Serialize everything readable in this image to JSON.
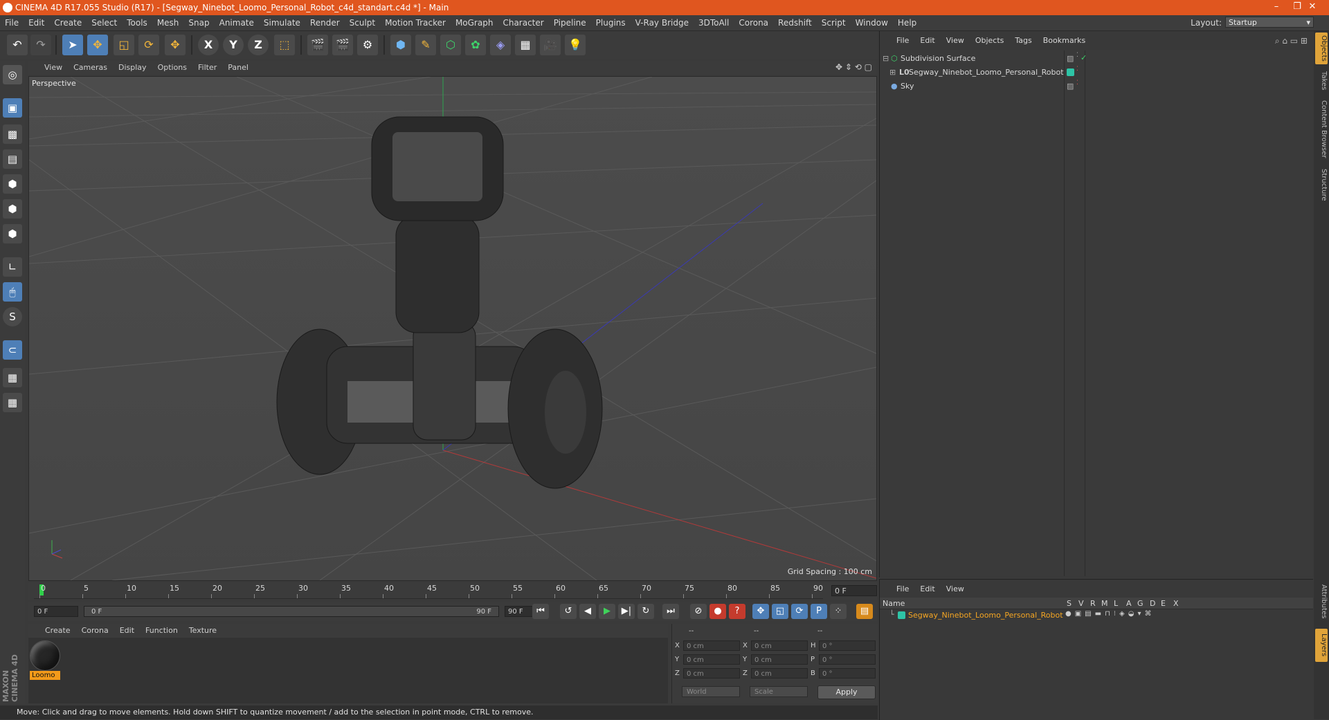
{
  "window": {
    "title": "CINEMA 4D R17.055 Studio (R17) - [Segway_Ninebot_Loomo_Personal_Robot_c4d_standart.c4d *] - Main",
    "controls": [
      "–",
      "❐",
      "✕"
    ]
  },
  "menubar": {
    "items": [
      "File",
      "Edit",
      "Create",
      "Select",
      "Tools",
      "Mesh",
      "Snap",
      "Animate",
      "Simulate",
      "Render",
      "Sculpt",
      "Motion Tracker",
      "MoGraph",
      "Character",
      "Pipeline",
      "Plugins",
      "V-Ray Bridge",
      "3DToAll",
      "Corona",
      "Redshift",
      "Script",
      "Window",
      "Help"
    ],
    "layout_label": "Layout:",
    "layout_value": "Startup"
  },
  "toolbar": {
    "icons": [
      "undo-icon",
      "redo-icon",
      "live-selection-icon",
      "move-icon",
      "scale-icon",
      "rotate-icon",
      "recent-tool-icon",
      "x-axis-icon",
      "y-axis-icon",
      "z-axis-icon",
      "world-coordinates-icon",
      "render-view-icon",
      "render-picture-viewer-icon",
      "edit-render-settings-icon",
      "cube-icon",
      "pen-spline-icon",
      "subdivision-surface-icon",
      "cloner-icon",
      "deformer-icon",
      "floor-icon",
      "camera-icon",
      "light-icon"
    ],
    "axis_labels": [
      "X",
      "Y",
      "Z"
    ]
  },
  "viewport": {
    "menu": [
      "View",
      "Cameras",
      "Display",
      "Options",
      "Filter",
      "Panel"
    ],
    "label": "Perspective",
    "grid_spacing": "Grid Spacing : 100 cm"
  },
  "timeline": {
    "ticks": [
      "0",
      "5",
      "10",
      "15",
      "20",
      "25",
      "30",
      "35",
      "40",
      "45",
      "50",
      "55",
      "60",
      "65",
      "70",
      "75",
      "80",
      "85",
      "90"
    ],
    "current_frame": "0 F",
    "start_field": "0 F",
    "range_start": "0 F",
    "range_end": "90 F",
    "end_field": "90 F"
  },
  "materials": {
    "menu": [
      "Create",
      "Corona",
      "Edit",
      "Function",
      "Texture"
    ],
    "items": [
      {
        "name": "Loomo"
      }
    ]
  },
  "coordinates": {
    "headers": [
      "--",
      "--",
      "--"
    ],
    "rows": [
      {
        "a_label": "X",
        "a_val": "0 cm",
        "b_label": "X",
        "b_val": "0 cm",
        "c_label": "H",
        "c_val": "0 °"
      },
      {
        "a_label": "Y",
        "a_val": "0 cm",
        "b_label": "Y",
        "b_val": "0 cm",
        "c_label": "P",
        "c_val": "0 °"
      },
      {
        "a_label": "Z",
        "a_val": "0 cm",
        "b_label": "Z",
        "b_val": "0 cm",
        "c_label": "B",
        "c_val": "0 °"
      }
    ],
    "mode": "World",
    "transform": "Scale",
    "apply": "Apply"
  },
  "status": "Move: Click and drag to move elements. Hold down SHIFT to quantize movement / add to the selection in point mode, CTRL to remove.",
  "object_manager": {
    "menu": [
      "File",
      "Edit",
      "View",
      "Objects",
      "Tags",
      "Bookmarks"
    ],
    "objects": [
      {
        "name": "Subdivision Surface"
      },
      {
        "name": "Segway_Ninebot_Loomo_Personal_Robot"
      },
      {
        "name": "Sky"
      }
    ],
    "tag_color": "#2ec4a6"
  },
  "layer_manager": {
    "menu": [
      "File",
      "Edit",
      "View"
    ],
    "header_name": "Name",
    "columns": [
      "S",
      "V",
      "R",
      "M",
      "L",
      "A",
      "G",
      "D",
      "E",
      "X"
    ],
    "layers": [
      {
        "name": "Segway_Ninebot_Loomo_Personal_Robot"
      }
    ]
  },
  "side_tabs": [
    "Objects",
    "Takes",
    "Content Browser",
    "Structure",
    "Attributes",
    "Layers"
  ],
  "brand": "MAXON CINEMA 4D",
  "colors": {
    "titlebar": "#e0561f",
    "accent_blue": "#4e7fb7",
    "active_orange": "#f39a1a"
  }
}
